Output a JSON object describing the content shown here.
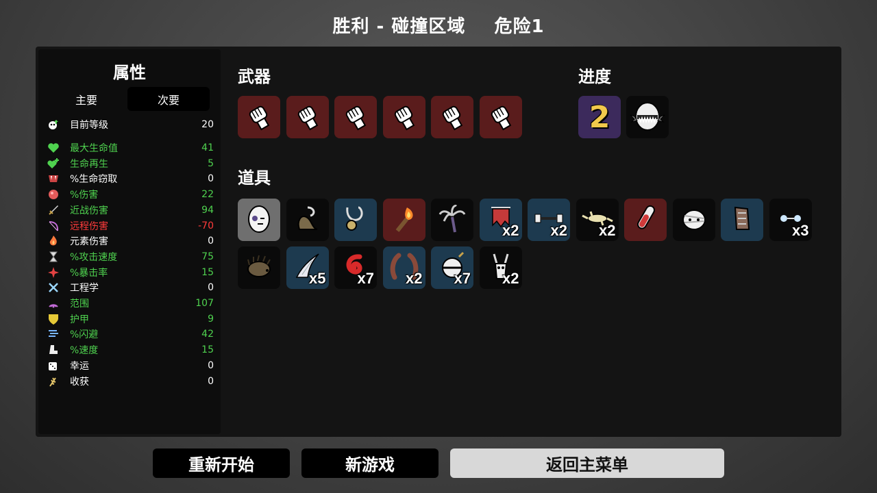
{
  "header": {
    "result": "胜利 - 碰撞区域",
    "danger": "危险1"
  },
  "stats": {
    "title": "属性",
    "tabs": [
      "主要",
      "次要"
    ],
    "level": {
      "label": "目前等级",
      "value": "20"
    },
    "rows": [
      {
        "label": "最大生命值",
        "value": "41",
        "color": "green",
        "icon": "heart-icon"
      },
      {
        "label": "生命再生",
        "value": "5",
        "color": "green",
        "icon": "heart-plus-icon"
      },
      {
        "label": "%生命窃取",
        "value": "0",
        "color": "white",
        "icon": "fangs-icon"
      },
      {
        "label": "%伤害",
        "value": "22",
        "color": "green",
        "icon": "muscle-icon"
      },
      {
        "label": "近战伤害",
        "value": "94",
        "color": "green",
        "icon": "sword-icon"
      },
      {
        "label": "远程伤害",
        "value": "-70",
        "color": "red",
        "icon": "bow-icon"
      },
      {
        "label": "元素伤害",
        "value": "0",
        "color": "white",
        "icon": "flame-icon"
      },
      {
        "label": "%攻击速度",
        "value": "75",
        "color": "green",
        "icon": "hourglass-icon"
      },
      {
        "label": "%暴击率",
        "value": "15",
        "color": "green",
        "icon": "crit-icon"
      },
      {
        "label": "工程学",
        "value": "0",
        "color": "white",
        "icon": "wrench-icon"
      },
      {
        "label": "范围",
        "value": "107",
        "color": "green",
        "icon": "range-icon"
      },
      {
        "label": "护甲",
        "value": "9",
        "color": "green",
        "icon": "shield-icon"
      },
      {
        "label": "%闪避",
        "value": "42",
        "color": "green",
        "icon": "dodge-icon"
      },
      {
        "label": "%速度",
        "value": "15",
        "color": "green",
        "icon": "boot-icon"
      },
      {
        "label": "幸运",
        "value": "0",
        "color": "white",
        "icon": "dice-icon"
      },
      {
        "label": "收获",
        "value": "0",
        "color": "white",
        "icon": "wheat-icon"
      }
    ]
  },
  "weapons": {
    "title": "武器",
    "slots": [
      "fist-icon",
      "fist-icon",
      "fist-icon",
      "fist-icon",
      "fist-icon",
      "fist-icon"
    ]
  },
  "progress": {
    "title": "进度",
    "level_number": "2",
    "items": [
      "spiked-egg-icon"
    ]
  },
  "items": {
    "title": "道具",
    "slots": [
      {
        "icon": "egg-icon",
        "bg": "grey",
        "qty": ""
      },
      {
        "icon": "snail-icon",
        "bg": "dark",
        "qty": ""
      },
      {
        "icon": "necklace-icon",
        "bg": "blue",
        "qty": ""
      },
      {
        "icon": "torch-icon",
        "bg": "red",
        "qty": ""
      },
      {
        "icon": "palm-tree-icon",
        "bg": "dark",
        "qty": ""
      },
      {
        "icon": "banner-icon",
        "bg": "blue",
        "qty": "x2"
      },
      {
        "icon": "dumbbell-icon",
        "bg": "blue",
        "qty": "x2"
      },
      {
        "icon": "lizard-icon",
        "bg": "dark",
        "qty": "x2"
      },
      {
        "icon": "potion-icon",
        "bg": "red",
        "qty": ""
      },
      {
        "icon": "mummy-icon",
        "bg": "dark",
        "qty": ""
      },
      {
        "icon": "cast-icon",
        "bg": "blue",
        "qty": ""
      },
      {
        "icon": "glasses-icon",
        "bg": "dark",
        "qty": "x3"
      },
      {
        "icon": "hedgehog-icon",
        "bg": "dark",
        "qty": ""
      },
      {
        "icon": "claw-icon",
        "bg": "blue",
        "qty": "x5"
      },
      {
        "icon": "red-worm-icon",
        "bg": "dark",
        "qty": "x7"
      },
      {
        "icon": "horns-icon",
        "bg": "blue",
        "qty": "x2"
      },
      {
        "icon": "ball-icon",
        "bg": "blue",
        "qty": "x7"
      },
      {
        "icon": "skull-icon",
        "bg": "dark",
        "qty": "x2"
      }
    ]
  },
  "buttons": {
    "restart": "重新开始",
    "new_game": "新游戏",
    "main_menu": "返回主菜单"
  },
  "colors": {
    "green": "#4fd24f",
    "red": "#ff3b3b",
    "white": "#ffffff"
  }
}
